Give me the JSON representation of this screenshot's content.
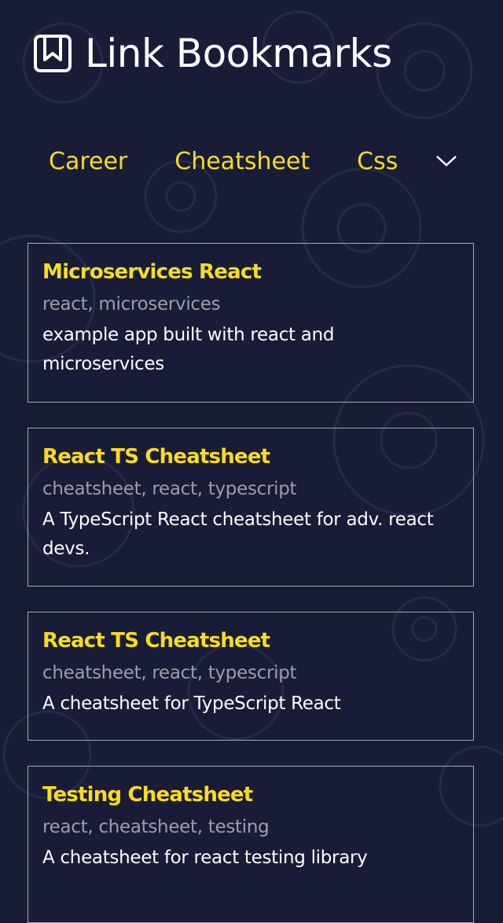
{
  "header": {
    "title": "Link Bookmarks",
    "icon": "bookmark-icon"
  },
  "nav": {
    "tabs": [
      "Career",
      "Cheatsheet",
      "Css"
    ],
    "more_icon": "chevron-down-icon"
  },
  "colors": {
    "background": "#181c36",
    "accent": "#fbdc1a",
    "tags": "#9c9ea8"
  },
  "bookmarks": [
    {
      "title": "Microservices React",
      "tags": "react, microservices",
      "description": "example app built with react and microservices"
    },
    {
      "title": "React TS Cheatsheet",
      "tags": "cheatsheet, react, typescript",
      "description": "A TypeScript React cheatsheet for adv. react devs."
    },
    {
      "title": "React TS Cheatsheet",
      "tags": "cheatsheet, react, typescript",
      "description": "A cheatsheet for TypeScript React"
    },
    {
      "title": "Testing Cheatsheet",
      "tags": "react, cheatsheet, testing",
      "description": "A cheatsheet for react testing library"
    }
  ]
}
